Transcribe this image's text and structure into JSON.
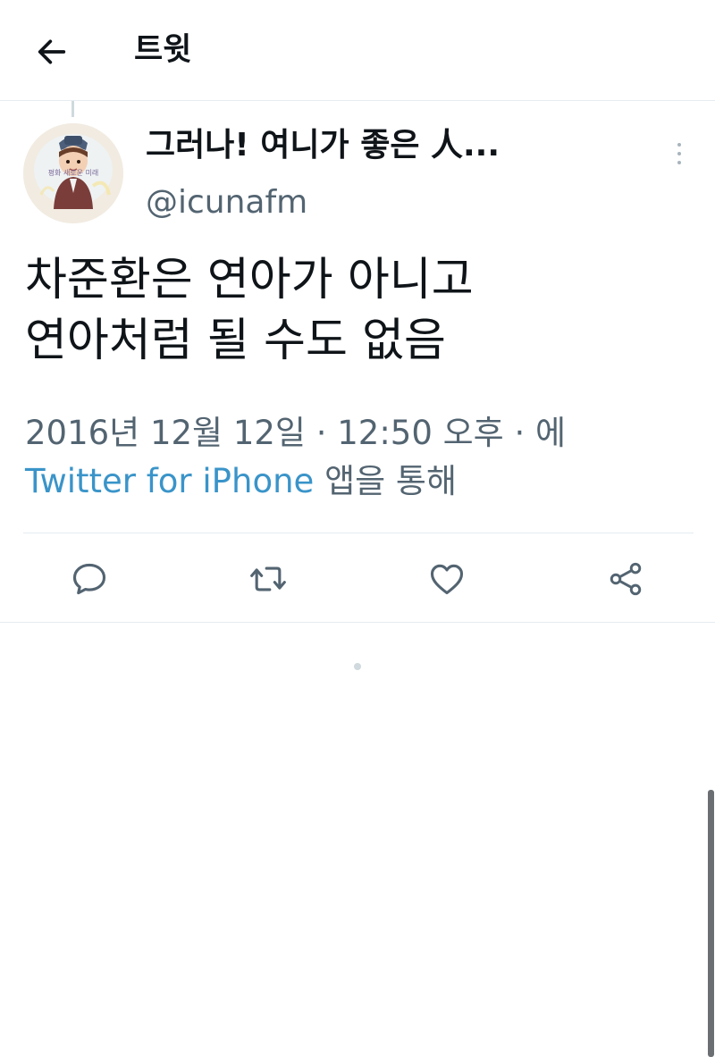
{
  "header": {
    "back_icon": "arrow-left-icon",
    "title": "트윗"
  },
  "author": {
    "name": "그러나! 여니가 좋은 人...",
    "handle": "@icunafm",
    "avatar_text": "평화 새로운 미래"
  },
  "tweet": {
    "lines": [
      "차준환은 연아가 아니고",
      "연아처럼 될 수도 없음"
    ]
  },
  "meta": {
    "line1": "2016년 12월 12일 · 12:50 오후 · 에",
    "source": "Twitter for iPhone",
    "suffix": " 앱을 통해"
  },
  "actions": {
    "reply_icon": "reply-icon",
    "retweet_icon": "retweet-icon",
    "like_icon": "heart-icon",
    "share_icon": "share-icon"
  },
  "colors": {
    "text": "#0f1419",
    "secondary": "#536471",
    "link": "#3a94c9",
    "divider": "#e6ecf0"
  }
}
